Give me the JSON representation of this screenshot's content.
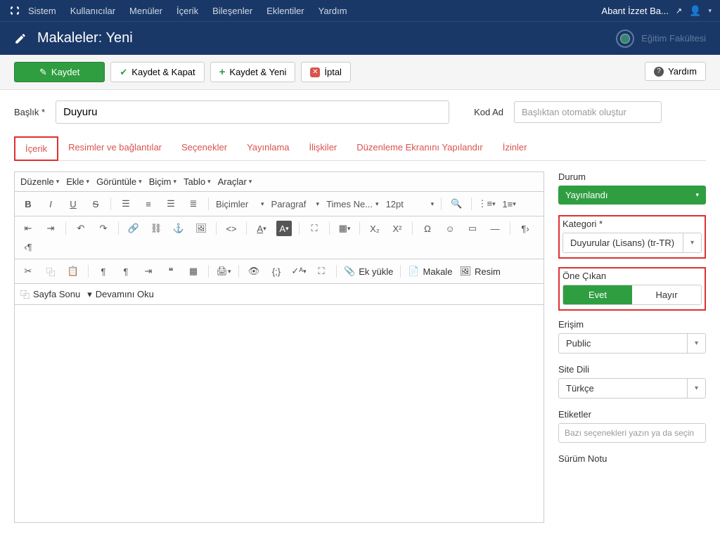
{
  "nav": {
    "items": [
      "Sistem",
      "Kullanıcılar",
      "Menüler",
      "İçerik",
      "Bileşenler",
      "Eklentiler",
      "Yardım"
    ],
    "site_name": "Abant İzzet Ba..."
  },
  "header": {
    "title": "Makaleler: Yeni",
    "brand": "Eğitim Fakültesi"
  },
  "toolbar": {
    "save": "Kaydet",
    "save_close": "Kaydet & Kapat",
    "save_new": "Kaydet & Yeni",
    "cancel": "İptal",
    "help": "Yardım"
  },
  "title_field": {
    "label": "Başlık *",
    "value": "Duyuru",
    "alias_label": "Kod Ad",
    "alias_placeholder": "Başlıktan otomatik oluştur"
  },
  "tabs": [
    "İçerik",
    "Resimler ve bağlantılar",
    "Seçenekler",
    "Yayınlama",
    "İlişkiler",
    "Düzenleme Ekranını Yapılandır",
    "İzinler"
  ],
  "editor_menus": [
    "Düzenle",
    "Ekle",
    "Görüntüle",
    "Biçim",
    "Tablo",
    "Araçlar"
  ],
  "editor_dropdowns": {
    "styles": "Biçimler",
    "format": "Paragraf",
    "font": "Times Ne...",
    "size": "12pt"
  },
  "editor_buttons": {
    "upload": "Ek yükle",
    "article": "Makale",
    "image": "Resim",
    "pagebreak": "Sayfa Sonu",
    "readmore": "Devamını Oku"
  },
  "sidebar": {
    "status_label": "Durum",
    "status_value": "Yayınlandı",
    "category_label": "Kategori *",
    "category_value": "Duyurular (Lisans) (tr-TR)",
    "featured_label": "Öne Çıkan",
    "featured_yes": "Evet",
    "featured_no": "Hayır",
    "access_label": "Erişim",
    "access_value": "Public",
    "language_label": "Site Dili",
    "language_value": "Türkçe",
    "tags_label": "Etiketler",
    "tags_placeholder": "Bazı seçenekleri yazın ya da seçin",
    "note_label": "Sürüm Notu"
  }
}
